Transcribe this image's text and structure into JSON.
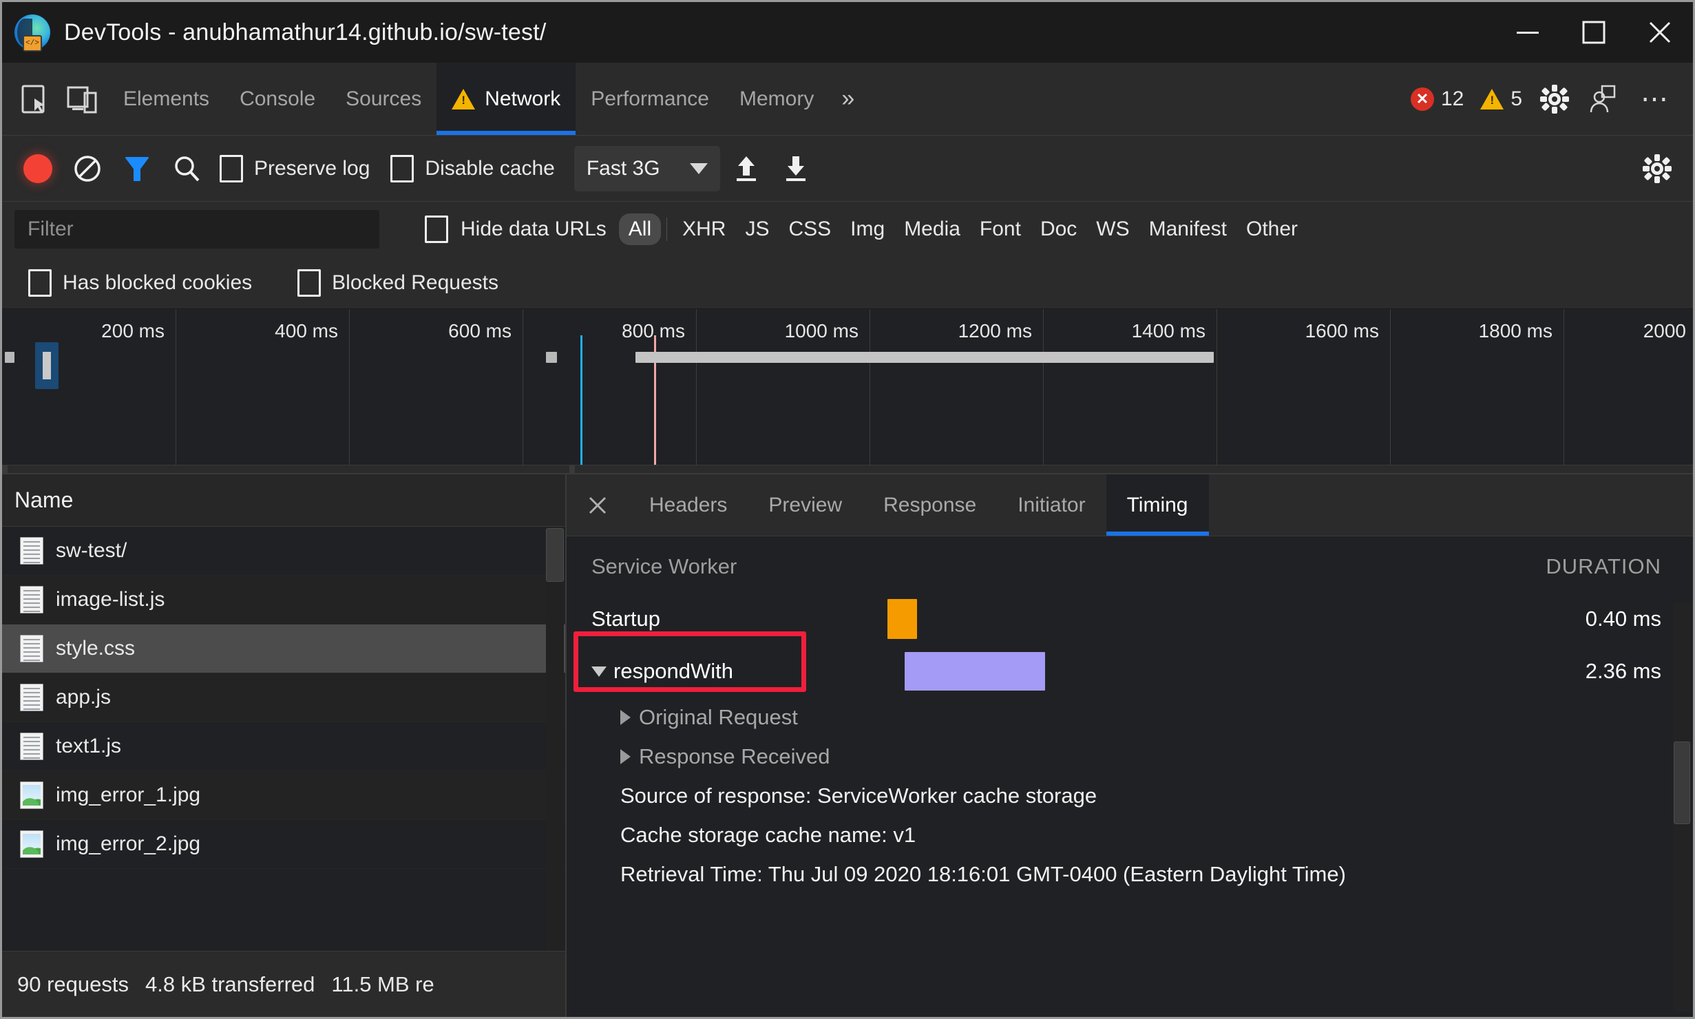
{
  "window": {
    "title": "DevTools - anubhamathur14.github.io/sw-test/",
    "logo_icon": "edge-devtools-icon",
    "minimize_icon": "minimize-icon",
    "maximize_icon": "maximize-icon",
    "close_icon": "close-icon"
  },
  "panel_tabs": {
    "inspect_icon": "inspect-element-icon",
    "device_icon": "device-toolbar-icon",
    "items": [
      {
        "label": "Elements",
        "active": false
      },
      {
        "label": "Console",
        "active": false
      },
      {
        "label": "Sources",
        "active": false
      },
      {
        "label": "Network",
        "active": true,
        "warning_icon": "warning-triangle-icon"
      },
      {
        "label": "Performance",
        "active": false
      },
      {
        "label": "Memory",
        "active": false
      }
    ],
    "more_tabs_icon": "double-chevron-right-icon",
    "error_count": "12",
    "warning_count": "5",
    "error_icon": "error-circle-icon",
    "warning_icon": "warning-triangle-icon",
    "settings_icon": "gear-icon",
    "feedback_icon": "feedback-person-icon",
    "more_icon": "more-options-icon"
  },
  "network_toolbar": {
    "record_icon": "record-stop-icon",
    "clear_icon": "clear-circle-slash-icon",
    "filter_icon": "filter-funnel-icon",
    "search_icon": "search-magnifier-icon",
    "preserve_log": {
      "label": "Preserve log",
      "checked": false
    },
    "disable_cache": {
      "label": "Disable cache",
      "checked": false
    },
    "throttling": {
      "value": "Fast 3G",
      "caret_icon": "chevron-down-icon"
    },
    "import_icon": "import-har-up-arrow-icon",
    "export_icon": "export-har-down-arrow-icon",
    "settings_icon": "gear-icon"
  },
  "filter_row": {
    "filter_placeholder": "Filter",
    "filter_value": "",
    "hide_data_urls": {
      "label": "Hide data URLs",
      "checked": false
    },
    "types": [
      {
        "label": "All",
        "active": true
      },
      {
        "label": "XHR",
        "active": false
      },
      {
        "label": "JS",
        "active": false
      },
      {
        "label": "CSS",
        "active": false
      },
      {
        "label": "Img",
        "active": false
      },
      {
        "label": "Media",
        "active": false
      },
      {
        "label": "Font",
        "active": false
      },
      {
        "label": "Doc",
        "active": false
      },
      {
        "label": "WS",
        "active": false
      },
      {
        "label": "Manifest",
        "active": false
      },
      {
        "label": "Other",
        "active": false
      }
    ],
    "has_blocked_cookies": {
      "label": "Has blocked cookies",
      "checked": false
    },
    "blocked_requests": {
      "label": "Blocked Requests",
      "checked": false
    }
  },
  "overview": {
    "tick_labels": [
      "200 ms",
      "400 ms",
      "600 ms",
      "800 ms",
      "1000 ms",
      "1200 ms",
      "1400 ms",
      "1600 ms",
      "1800 ms",
      "2000 "
    ],
    "dom_content_loaded_color": "#1db0f5",
    "load_event_color": "#f4a7a7",
    "bar_color": "#c4c4c4",
    "selected_bar_color": "#1a4a75"
  },
  "request_list": {
    "column_header": "Name",
    "rows": [
      {
        "name": "sw-test/",
        "icon": "document-icon",
        "selected": false
      },
      {
        "name": "image-list.js",
        "icon": "document-icon",
        "selected": false
      },
      {
        "name": "style.css",
        "icon": "document-icon",
        "selected": true
      },
      {
        "name": "app.js",
        "icon": "document-icon",
        "selected": false
      },
      {
        "name": "text1.js",
        "icon": "document-icon",
        "selected": false
      },
      {
        "name": "img_error_1.jpg",
        "icon": "image-icon",
        "selected": false
      },
      {
        "name": "img_error_2.jpg",
        "icon": "image-icon",
        "selected": false
      }
    ],
    "status": {
      "requests": "90 requests",
      "transferred": "4.8 kB transferred",
      "resources": "11.5 MB re"
    }
  },
  "detail_panel": {
    "close_icon": "close-icon",
    "tabs": [
      {
        "label": "Headers",
        "active": false
      },
      {
        "label": "Preview",
        "active": false
      },
      {
        "label": "Response",
        "active": false
      },
      {
        "label": "Initiator",
        "active": false
      },
      {
        "label": "Timing",
        "active": true
      }
    ],
    "timing": {
      "section_title": "Service Worker",
      "duration_header": "DURATION",
      "phases": [
        {
          "label": "Startup",
          "duration": "0.40 ms",
          "bar_color": "#f59b00",
          "bar_left_pct": 28.5,
          "bar_width_pct": 2.6,
          "expandable": false,
          "highlighted": false
        },
        {
          "label": "respondWith",
          "duration": "2.36 ms",
          "bar_color": "#a39bf5",
          "bar_left_pct": 30.0,
          "bar_width_pct": 12.5,
          "expandable": true,
          "expanded": true,
          "highlighted": true,
          "caret_icon": "caret-down-icon"
        }
      ],
      "sub_items": [
        {
          "label": "Original Request",
          "caret_icon": "caret-right-icon"
        },
        {
          "label": "Response Received",
          "caret_icon": "caret-right-icon"
        }
      ],
      "info_lines": [
        "Source of response: ServiceWorker cache storage",
        "Cache storage cache name: v1",
        "Retrieval Time: Thu Jul 09 2020 18:16:01 GMT-0400 (Eastern Daylight Time)"
      ]
    }
  }
}
